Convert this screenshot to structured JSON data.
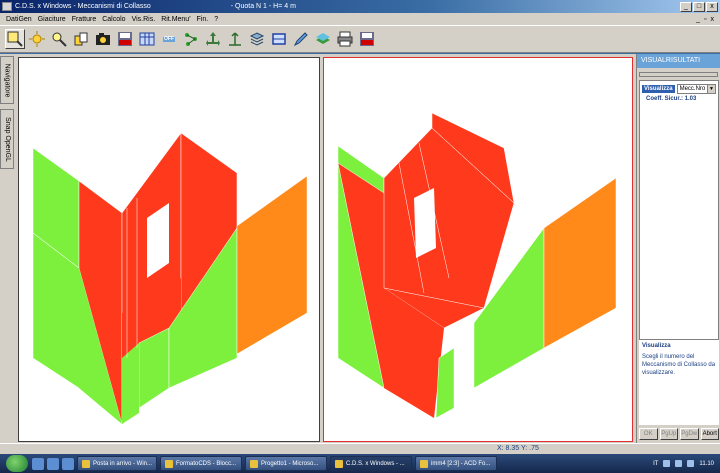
{
  "window": {
    "title": "C.D.S. x Windows - Meccanismi di Collasso",
    "quota": "- Quota N 1 - H= 4 m",
    "min_glyph": "_",
    "max_glyph": "□",
    "close_glyph": "x"
  },
  "menu": {
    "items": [
      "DatiGen",
      "Giaciture",
      "Fratture",
      "Calcolo",
      "Vis.Ris.",
      "Rit.Menu'",
      "Fin.",
      "?"
    ],
    "mdi_min": "_",
    "mdi_restore": "▫",
    "mdi_close": "x"
  },
  "toolbar": {
    "icons": [
      "zoom-window-icon",
      "zoom-all-icon",
      "zoom-icon",
      "rotate-icon",
      "camera-icon",
      "save-bmp-icon",
      "table-off-icon",
      "off-icon",
      "nodes-icon",
      "pan-icon",
      "axes-icon",
      "stack-icon",
      "frame-icon",
      "edit-icon",
      "layers-icon",
      "print-icon",
      "save-bmp-2-icon"
    ],
    "off_label": "OFF",
    "bmp_label": "BMP"
  },
  "left_tabs": {
    "navigatore": "Navigatore",
    "snap": "Snap OpenGL"
  },
  "right_panel": {
    "title": "VISUALRISULTATI",
    "visualizza_label": "Visualizza",
    "mecc_value": "Mecc.Nro 2",
    "coeff_label": "Coeff. Sicur.: 1.03",
    "help_title": "Visualizza",
    "help_text": "Scegli il numero del Meccanismo di Collasso da visualizzare.",
    "buttons": [
      "OK",
      "PgUp",
      "PgDw",
      "Abort"
    ]
  },
  "status": {
    "coords": "X: 8.35  Y:   .75"
  },
  "taskbar": {
    "tasks": [
      "Posta in arrivo - Win...",
      "FormatoCDS - Blocc...",
      "Progetto1 - Microso...",
      "C.D.S. x Windows - ...",
      "imm4 [2:3] - ACD Fo..."
    ],
    "lang": "IT",
    "time": "11.10"
  },
  "colors": {
    "wall_red": "#ff3a1c",
    "wall_green": "#7cf03c",
    "wall_orange": "#ff8a1a",
    "panel_header": "#6aa3d8",
    "view_active_border": "#e03030"
  }
}
